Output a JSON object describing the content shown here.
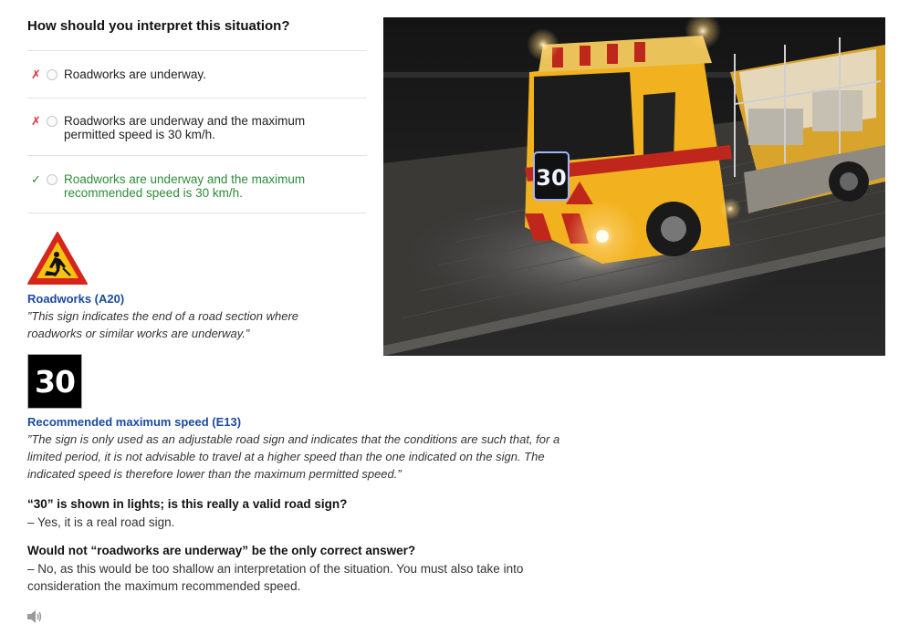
{
  "question": "How should you interpret this situation?",
  "options": [
    {
      "text": "Roadworks are underway.",
      "result": "wrong",
      "mark": "✗"
    },
    {
      "text": "Roadworks are underway and the maximum permitted speed is 30 km/h.",
      "result": "wrong",
      "mark": "✗"
    },
    {
      "text": "Roadworks are underway and the maximum recommended speed is 30 km/h.",
      "result": "correct",
      "mark": "✓"
    }
  ],
  "signs": [
    {
      "icon": "roadworks-warning-icon",
      "title": "Roadworks (A20)",
      "quote": "”This sign indicates the end of a road section where roadworks or similar works are underway.”"
    },
    {
      "icon": "recommended-speed-sign-icon",
      "number": "30",
      "title": "Recommended maximum speed (E13)",
      "quote": "”The sign is only used as an adjustable road sign and indicates that the conditions are such that, for a limited period, it is not advisable to travel at a higher speed than the one indicated on the sign. The indicated speed is therefore lower than the maximum permitted speed.”"
    }
  ],
  "faq": [
    {
      "q": "“30” is shown in lights; is this really a valid road sign?",
      "a": "– Yes, it is a real road sign."
    },
    {
      "q": "Would not “roadworks are underway” be the only correct answer?",
      "a": "– No, as this would be too shallow an interpretation of the situation. You must also take into consideration the maximum recommended speed."
    }
  ],
  "photo": {
    "sign_number": "30"
  },
  "audio": {
    "icon": "speaker-icon"
  },
  "colors": {
    "correct": "#2e8b3a",
    "wrong": "#dd3333",
    "link_title": "#1a4a9c",
    "truck": "#f2b21f"
  }
}
